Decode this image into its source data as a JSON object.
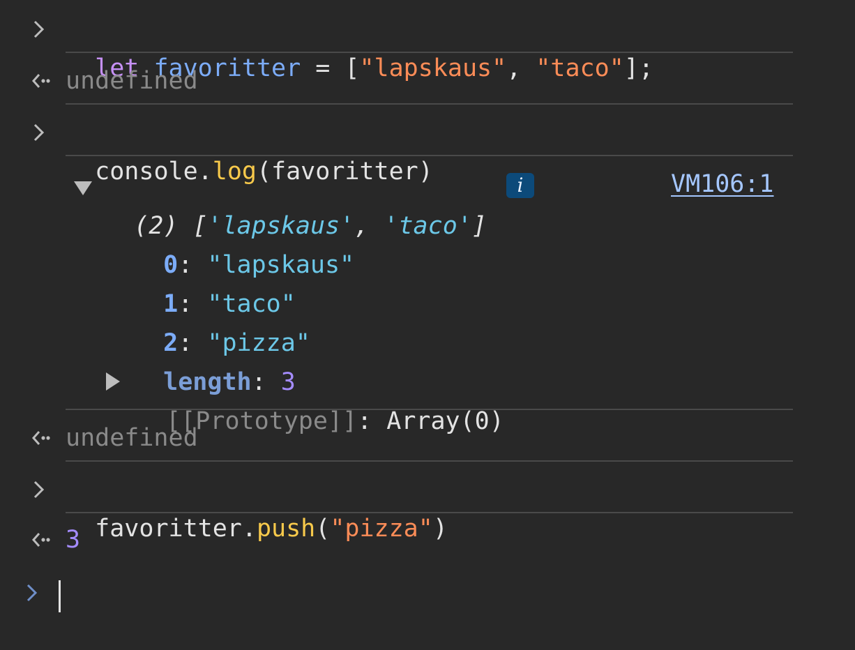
{
  "console": {
    "entry1": {
      "keyword": "let",
      "varname": "favoritter",
      "eq": " = ",
      "open": "[",
      "s1": "\"lapskaus\"",
      "comma": ", ",
      "s2": "\"taco\"",
      "close": "];"
    },
    "result1": "undefined",
    "entry2": {
      "obj": "console",
      "dot": ".",
      "method": "log",
      "args": "(favoritter)"
    },
    "log": {
      "preview_count": "(2)",
      "preview_open": "[",
      "preview_s1": "'lapskaus'",
      "preview_comma": ", ",
      "preview_s2": "'taco'",
      "preview_close": "]",
      "info_badge": "i",
      "source_link": "VM106:1",
      "items": [
        {
          "key": "0",
          "sep": ": ",
          "value": "\"lapskaus\""
        },
        {
          "key": "1",
          "sep": ": ",
          "value": "\"taco\""
        },
        {
          "key": "2",
          "sep": ": ",
          "value": "\"pizza\""
        }
      ],
      "length_key": "length",
      "length_sep": ": ",
      "length_value": "3",
      "prototype_key": "[[Prototype]]",
      "prototype_sep": ": ",
      "prototype_value": "Array(0)"
    },
    "result2": "undefined",
    "entry3": {
      "obj": "favoritter",
      "dot": ".",
      "method": "push",
      "open": "(",
      "arg": "\"pizza\"",
      "close": ")"
    },
    "result3": "3"
  },
  "icons": {
    "input_prompt": "chevron-right-icon",
    "result": "return-arrow-icon",
    "expand": "triangle-down-icon",
    "collapse": "triangle-right-icon"
  },
  "colors": {
    "background": "#282828",
    "keyword": "#c690f6",
    "variable": "#7cacf8",
    "string": "#fb8c57",
    "function": "#f7c94b",
    "number": "#a58cff",
    "link": "#a5c7ff"
  }
}
